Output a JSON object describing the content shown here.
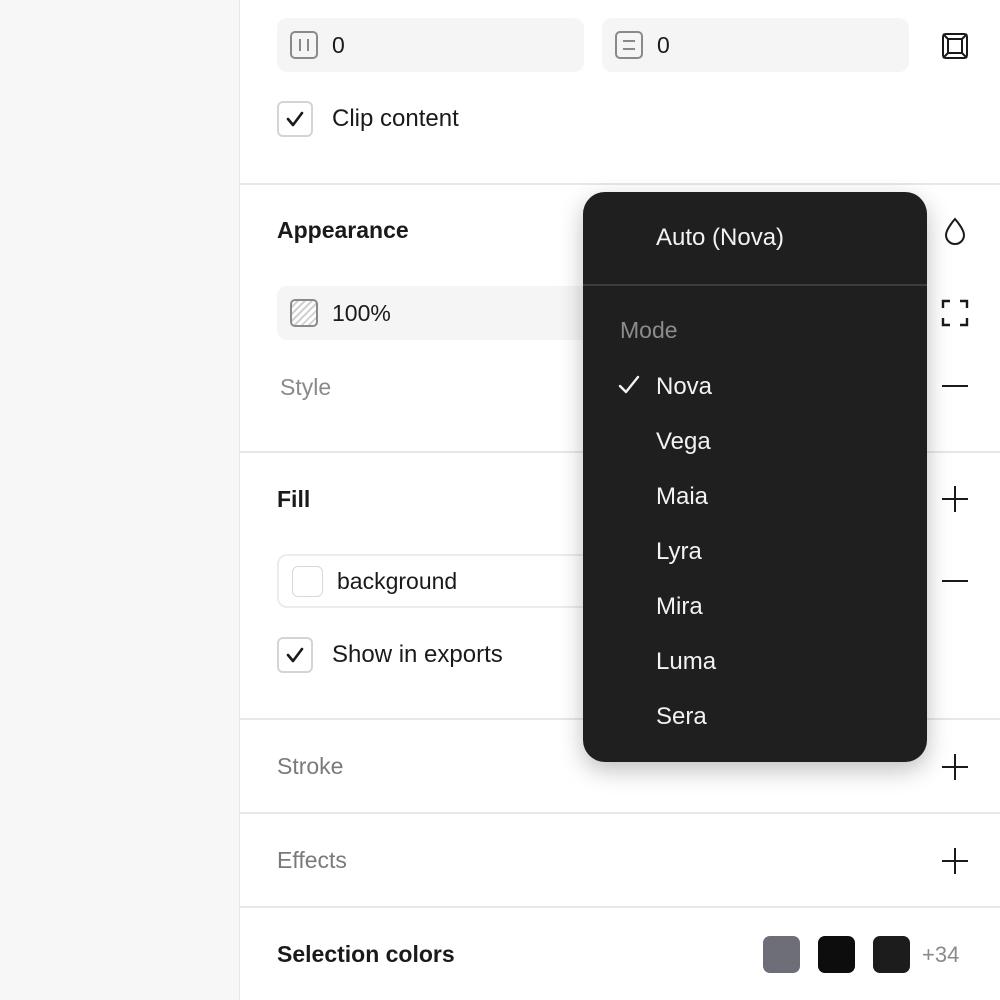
{
  "layout": {
    "field_x_value": "0",
    "field_y_value": "0",
    "clip_content_label": "Clip content",
    "clip_content_checked": true
  },
  "appearance": {
    "title": "Appearance",
    "opacity_value": "100%",
    "style_label": "Style"
  },
  "fill": {
    "title": "Fill",
    "variable_name": "background",
    "show_in_exports_label": "Show in exports",
    "show_in_exports_checked": true
  },
  "stroke": {
    "title": "Stroke"
  },
  "effects": {
    "title": "Effects"
  },
  "selection_colors": {
    "title": "Selection colors",
    "swatches": [
      "#6e6e78",
      "#0d0d0d",
      "#1c1c1c"
    ],
    "more_count": "+34"
  },
  "mode_menu": {
    "auto_label": "Auto (Nova)",
    "section_header": "Mode",
    "selected": "Nova",
    "items": [
      "Nova",
      "Vega",
      "Maia",
      "Lyra",
      "Mira",
      "Luma",
      "Sera"
    ]
  },
  "icons": {
    "horizontal_padding": "padding-horizontal-icon",
    "vertical_padding": "padding-vertical-icon",
    "individual_padding": "individual-padding-icon",
    "blend": "droplet-icon",
    "visibility_bounds": "corners-icon",
    "remove": "minus-icon",
    "add": "plus-icon",
    "check": "check-icon"
  }
}
